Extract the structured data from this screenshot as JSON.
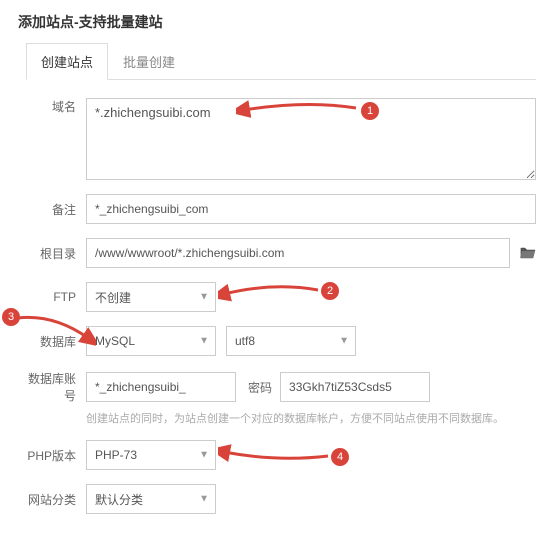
{
  "title": "添加站点-支持批量建站",
  "tabs": {
    "create": "创建站点",
    "batch": "批量创建"
  },
  "labels": {
    "domain": "域名",
    "remark": "备注",
    "root": "根目录",
    "ftp": "FTP",
    "db": "数据库",
    "db_account": "数据库账号",
    "password": "密码",
    "php": "PHP版本",
    "category": "网站分类"
  },
  "values": {
    "domain": "*.zhichengsuibi.com",
    "remark": "*_zhichengsuibi_com",
    "root": "/www/wwwroot/*.zhichengsuibi.com",
    "ftp": "不创建",
    "db": "MySQL",
    "charset": "utf8",
    "db_account": "*_zhichengsuibi_",
    "password": "33Gkh7tiZ53Csds5",
    "php": "PHP-73",
    "category": "默认分类"
  },
  "hint": "创建站点的同时，为站点创建一个对应的数据库帐户，方便不同站点使用不同数据库。",
  "badges": {
    "b1": "1",
    "b2": "2",
    "b3": "3",
    "b4": "4"
  }
}
